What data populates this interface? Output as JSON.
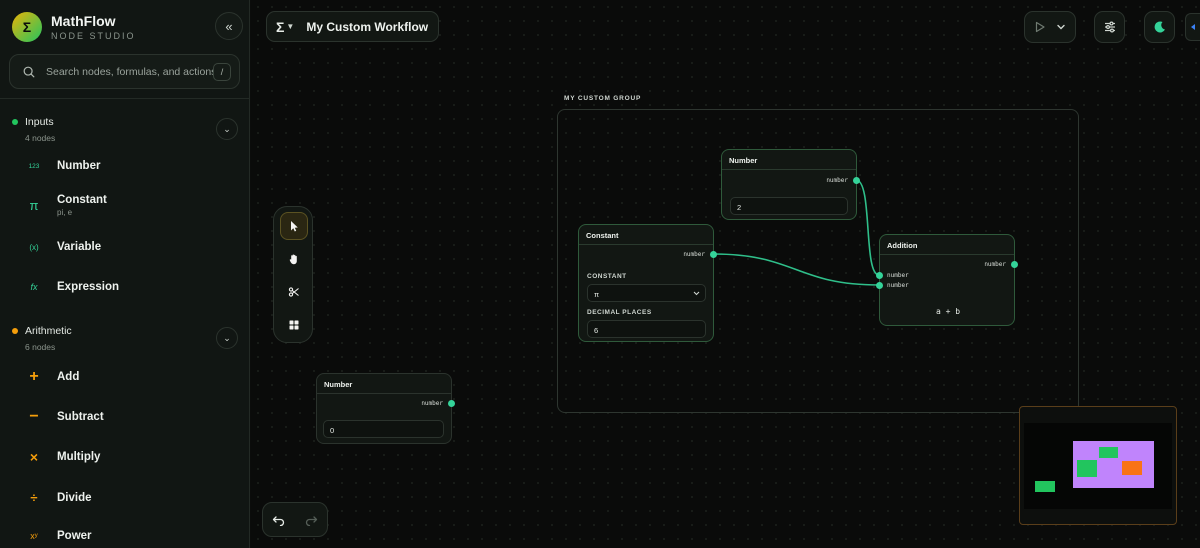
{
  "brand": {
    "name": "MathFlow",
    "subtitle": "NODE STUDIO",
    "logo_icon": "Σ"
  },
  "search": {
    "placeholder": "Search nodes, formulas, and actions",
    "shortcut": "/"
  },
  "categories": [
    {
      "name": "Inputs",
      "count": "4 nodes",
      "dot_color": "#22c55e",
      "items": [
        {
          "icon": "123",
          "label": "Number"
        },
        {
          "icon": "π",
          "label": "Constant",
          "sub": "pi, e"
        },
        {
          "icon": "(x)",
          "label": "Variable"
        },
        {
          "icon": "fx",
          "label": "Expression"
        }
      ]
    },
    {
      "name": "Arithmetic",
      "count": "6 nodes",
      "dot_color": "#f59e0b",
      "items": [
        {
          "icon": "+",
          "label": "Add"
        },
        {
          "icon": "−",
          "label": "Subtract"
        },
        {
          "icon": "×",
          "label": "Multiply"
        },
        {
          "icon": "÷",
          "label": "Divide"
        },
        {
          "icon": "xʸ",
          "label": "Power"
        }
      ]
    }
  ],
  "workflow": {
    "icon": "Σ",
    "title": "My Custom Workflow"
  },
  "group": {
    "label": "MY CUSTOM GROUP"
  },
  "nodes": {
    "number_top": {
      "title": "Number",
      "output": "number",
      "value": "2"
    },
    "constant": {
      "title": "Constant",
      "output": "number",
      "constant_label": "CONSTANT",
      "constant_value": "π",
      "decimals_label": "DECIMAL PLACES",
      "decimals_value": "6"
    },
    "addition": {
      "title": "Addition",
      "input_a": "number",
      "input_b": "number",
      "output": "number",
      "formula": "a + b"
    },
    "number_bottom": {
      "title": "Number",
      "output": "number",
      "value": "0"
    }
  },
  "colors": {
    "accent": "#34d399",
    "edge": "#2fbf8a",
    "minimap_group": "#c084fc",
    "minimap_node": "#22c55e",
    "minimap_op": "#f97316"
  }
}
